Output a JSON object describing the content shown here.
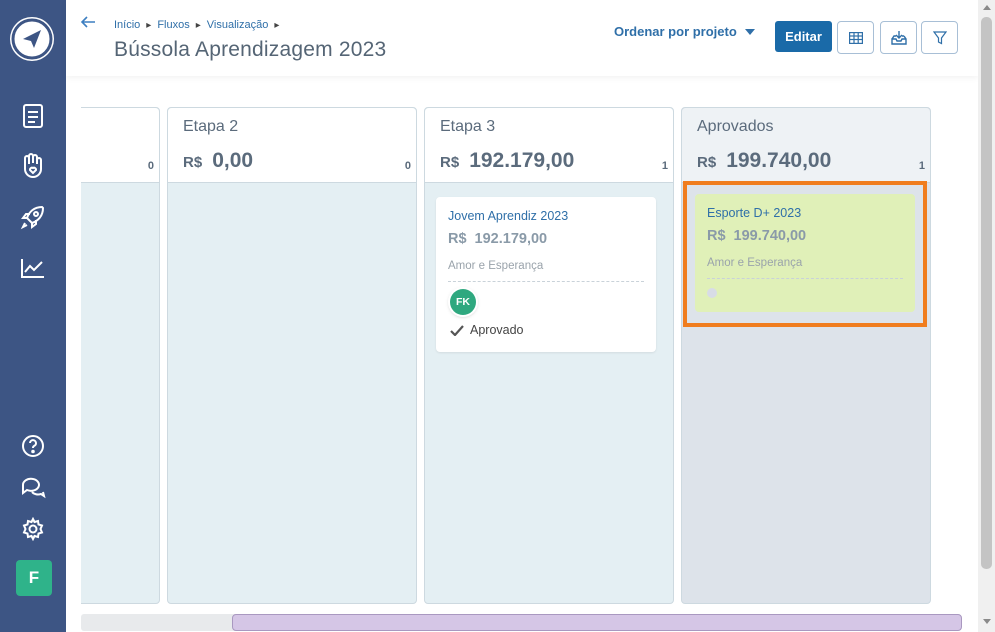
{
  "breadcrumbs": [
    "Início",
    "Fluxos",
    "Visualização"
  ],
  "page_title": "Bússola Aprendizagem 2023",
  "sort_label": "Ordenar por projeto",
  "edit_label": "Editar",
  "sidebar": {
    "icons": [
      "document-icon",
      "hand-heart-icon",
      "rocket-icon",
      "chart-line-icon",
      "help-icon",
      "chat-icon",
      "gear-icon"
    ],
    "avatar_initial": "F"
  },
  "columns": [
    {
      "name": "",
      "currency": "",
      "total": "",
      "count": "0"
    },
    {
      "name": "Etapa 2",
      "currency": "R$",
      "total": "0,00",
      "count": "0"
    },
    {
      "name": "Etapa 3",
      "currency": "R$",
      "total": "192.179,00",
      "count": "1"
    },
    {
      "name": "Aprovados",
      "currency": "R$",
      "total": "199.740,00",
      "count": "1"
    }
  ],
  "cards": [
    {
      "title": "Jovem Aprendiz 2023",
      "currency": "R$",
      "amount": "192.179,00",
      "org": "Amor e Esperança",
      "avatar": "FK",
      "status": "Aprovado"
    },
    {
      "title": "Esporte D+ 2023",
      "currency": "R$",
      "amount": "199.740,00",
      "org": "Amor e Esperança"
    }
  ],
  "colors": {
    "sidebar": "#3d5584",
    "accent": "#1a6aa8",
    "highlight": "#f07d1e",
    "approved_card": "#e0f0b8"
  }
}
